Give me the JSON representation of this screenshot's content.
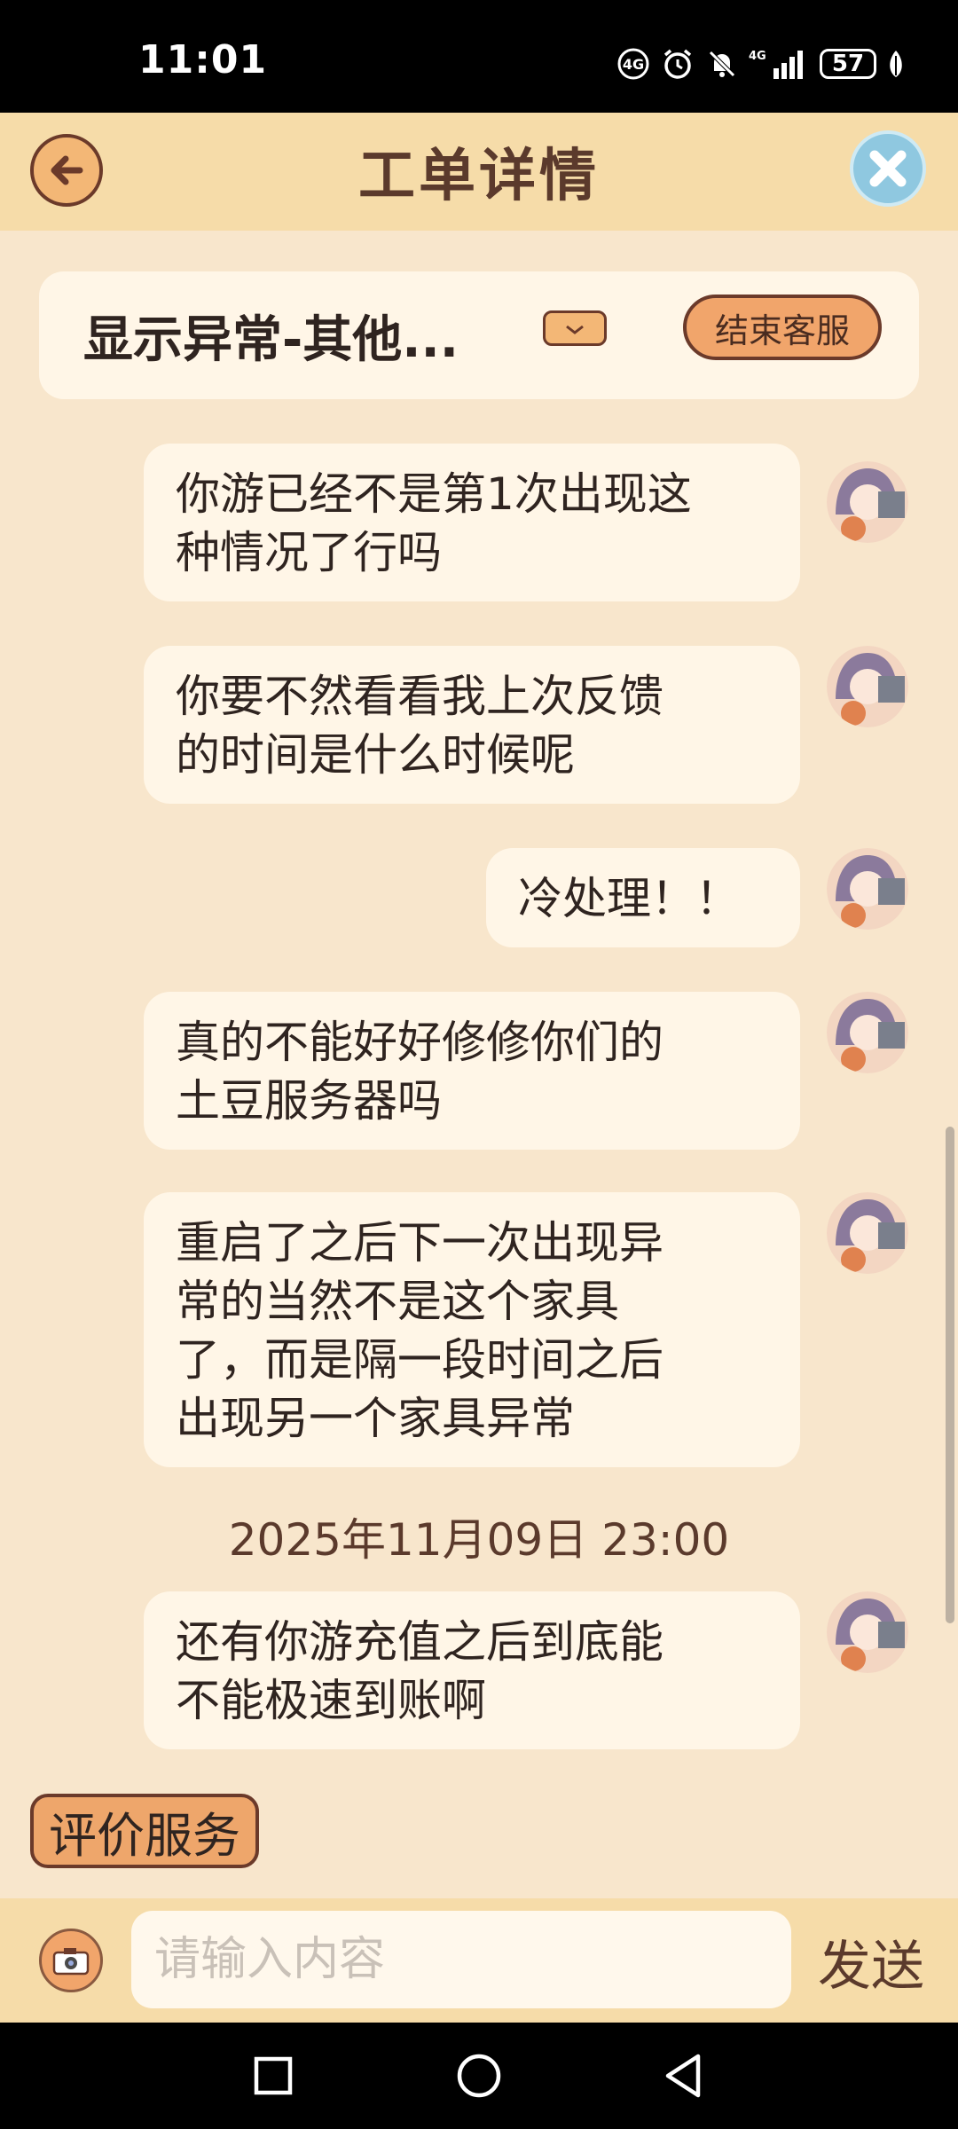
{
  "status_bar": {
    "time": "11:01",
    "network": "4G",
    "battery": "57",
    "icons": [
      "hd-icon",
      "alarm-icon",
      "mute-icon",
      "signal-icon",
      "battery-icon",
      "leaf-icon"
    ]
  },
  "header": {
    "title": "工单详情",
    "back_icon": "back-arrow-icon",
    "close_icon": "close-icon"
  },
  "ticket": {
    "title": "显示异常-其他...",
    "end_service_label": "结束客服"
  },
  "messages": [
    {
      "lines": [
        "你游已经不是第1次出现这",
        "种情况了行吗"
      ]
    },
    {
      "lines": [
        "你要不然看看我上次反馈",
        "的时间是什么时候呢"
      ]
    },
    {
      "lines": [
        "冷处理！！"
      ]
    },
    {
      "lines": [
        "真的不能好好修修你们的",
        "土豆服务器吗"
      ]
    },
    {
      "lines": [
        "重启了之后下一次出现异",
        "常的当然不是这个家具",
        "了，而是隔一段时间之后",
        "出现另一个家具异常"
      ]
    },
    {
      "lines": [
        "还有你游充值之后到底能",
        "不能极速到账啊"
      ]
    }
  ],
  "timestamp": "2025年11月09日 23:00",
  "rate_label": "评价服务",
  "input": {
    "placeholder": "请输入内容",
    "value": ""
  },
  "send_label": "发送",
  "colors": {
    "background": "#f8e6cc",
    "header": "#f6dca9",
    "bubble": "#fff6e7",
    "button": "#f1a56b",
    "border": "#6b3a2a"
  }
}
